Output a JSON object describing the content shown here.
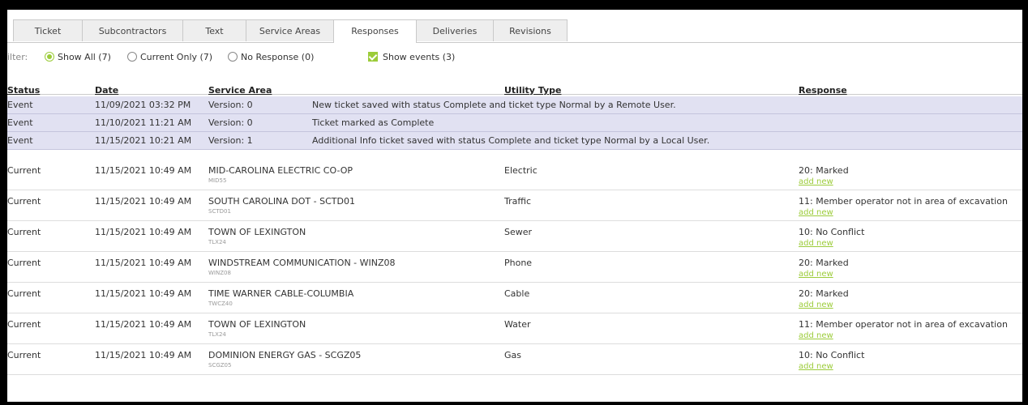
{
  "tabs": [
    "Ticket",
    "Subcontractors",
    "Text",
    "Service Areas",
    "Responses",
    "Deliveries",
    "Revisions"
  ],
  "active_tab": "Responses",
  "filter": {
    "label": "ilter:",
    "options": [
      "Show All (7)",
      "Current Only (7)",
      "No Response (0)"
    ],
    "selected": "Show All (7)",
    "show_events": "Show events (3)"
  },
  "columns": {
    "status": "Status",
    "date": "Date",
    "service_area": "Service Area",
    "utility_type": "Utility Type",
    "response": "Response"
  },
  "events": [
    {
      "status": "Event",
      "date": "11/09/2021 03:32 PM",
      "version": "Version: 0",
      "message": "New ticket saved with status Complete and ticket type Normal by a Remote User."
    },
    {
      "status": "Event",
      "date": "11/10/2021 11:21 AM",
      "version": "Version: 0",
      "message": "Ticket marked as Complete"
    },
    {
      "status": "Event",
      "date": "11/15/2021 10:21 AM",
      "version": "Version: 1",
      "message": "Additional Info ticket saved with status Complete and ticket type Normal by a Local User."
    }
  ],
  "rows": [
    {
      "status": "Current",
      "date": "11/15/2021 10:49 AM",
      "area": "MID-CAROLINA ELECTRIC CO-OP",
      "code": "MID55",
      "utility": "Electric",
      "response": "20: Marked",
      "add": "add new"
    },
    {
      "status": "Current",
      "date": "11/15/2021 10:49 AM",
      "area": "SOUTH CAROLINA DOT - SCTD01",
      "code": "SCTD01",
      "utility": "Traffic",
      "response": "11: Member operator not in area of excavation",
      "add": "add new"
    },
    {
      "status": "Current",
      "date": "11/15/2021 10:49 AM",
      "area": "TOWN OF LEXINGTON",
      "code": "TLX24",
      "utility": "Sewer",
      "response": "10: No Conflict",
      "add": "add new"
    },
    {
      "status": "Current",
      "date": "11/15/2021 10:49 AM",
      "area": "WINDSTREAM COMMUNICATION - WINZ08",
      "code": "WINZ08",
      "utility": "Phone",
      "response": "20: Marked",
      "add": "add new"
    },
    {
      "status": "Current",
      "date": "11/15/2021 10:49 AM",
      "area": "TIME WARNER CABLE-COLUMBIA",
      "code": "TWCZ40",
      "utility": "Cable",
      "response": "20: Marked",
      "add": "add new"
    },
    {
      "status": "Current",
      "date": "11/15/2021 10:49 AM",
      "area": "TOWN OF LEXINGTON",
      "code": "TLX24",
      "utility": "Water",
      "response": "11: Member operator not in area of excavation",
      "add": "add new"
    },
    {
      "status": "Current",
      "date": "11/15/2021 10:49 AM",
      "area": "DOMINION ENERGY GAS - SCGZ05",
      "code": "SCGZ05",
      "utility": "Gas",
      "response": "10: No Conflict",
      "add": "add new"
    }
  ],
  "colors": {
    "accent": "#9ccc3a",
    "event_row": "#e1e1f2",
    "tab_bg": "#eeeeee"
  }
}
